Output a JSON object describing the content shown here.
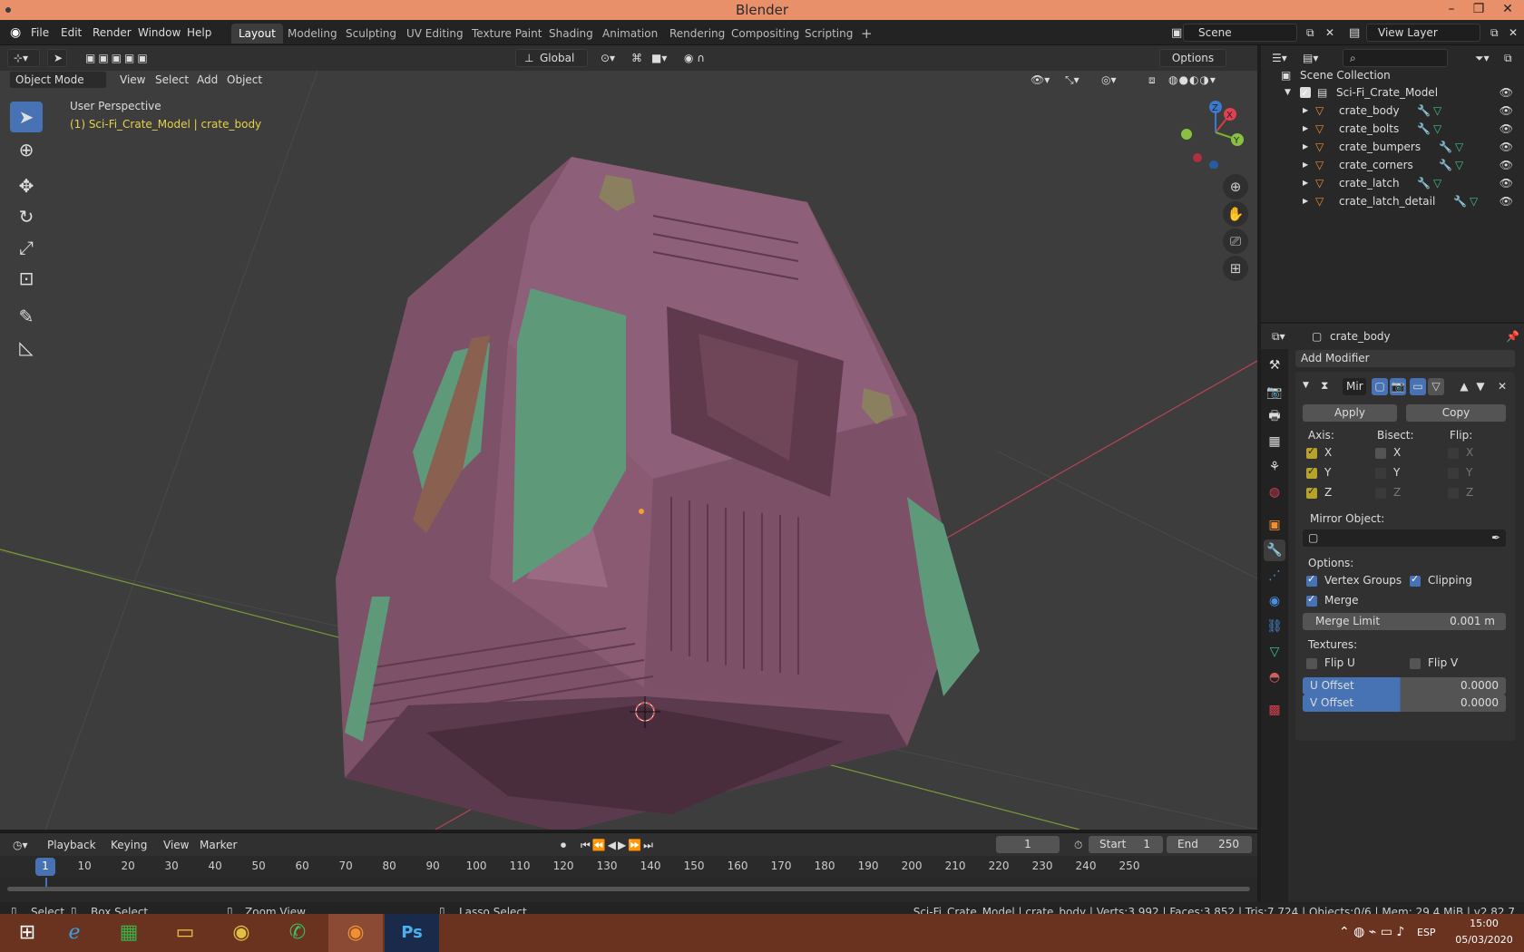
{
  "app_title": "Blender",
  "menu": [
    "File",
    "Edit",
    "Render",
    "Window",
    "Help"
  ],
  "workspaces": [
    "Layout",
    "Modeling",
    "Sculpting",
    "UV Editing",
    "Texture Paint",
    "Shading",
    "Animation",
    "Rendering",
    "Compositing",
    "Scripting"
  ],
  "active_workspace": "Layout",
  "scene_field": "Scene",
  "view_layer_field": "View Layer",
  "transform_orientation": "Global",
  "options_label": "Options",
  "viewport": {
    "mode": "Object Mode",
    "menus": [
      "View",
      "Select",
      "Add",
      "Object"
    ],
    "perspective_label": "User Perspective",
    "active_info": "(1) Sci-Fi_Crate_Model | crate_body",
    "gizmo_axes": {
      "x": "X",
      "y": "Y",
      "z": "Z"
    }
  },
  "outliner": {
    "root": "Scene Collection",
    "collection": "Sci-Fi_Crate_Model",
    "objects": [
      "crate_body",
      "crate_bolts",
      "crate_bumpers",
      "crate_corners",
      "crate_latch",
      "crate_latch_detail"
    ]
  },
  "properties": {
    "object_name": "crate_body",
    "add_modifier": "Add Modifier",
    "modifier_name": "Mir",
    "apply": "Apply",
    "copy": "Copy",
    "axis_label": "Axis:",
    "bisect_label": "Bisect:",
    "flip_label": "Flip:",
    "axes": [
      "X",
      "Y",
      "Z"
    ],
    "axis_checked": [
      true,
      true,
      true
    ],
    "mirror_object_label": "Mirror Object:",
    "options_label": "Options:",
    "vertex_groups": "Vertex Groups",
    "clipping": "Clipping",
    "merge": "Merge",
    "merge_limit_label": "Merge Limit",
    "merge_limit_value": "0.001 m",
    "textures_label": "Textures:",
    "flip_u": "Flip U",
    "flip_v": "Flip V",
    "u_offset_label": "U Offset",
    "u_offset_value": "0.0000",
    "v_offset_label": "V Offset",
    "v_offset_value": "0.0000"
  },
  "timeline": {
    "menus": [
      "Playback",
      "Keying",
      "View",
      "Marker"
    ],
    "current_frame": "1",
    "start_label": "Start",
    "start_value": "1",
    "end_label": "End",
    "end_value": "250",
    "ruler": [
      "1",
      "10",
      "20",
      "30",
      "40",
      "50",
      "60",
      "70",
      "80",
      "90",
      "100",
      "110",
      "120",
      "130",
      "140",
      "150",
      "160",
      "170",
      "180",
      "190",
      "200",
      "210",
      "220",
      "230",
      "240",
      "250"
    ]
  },
  "statusbar": {
    "select": "Select",
    "box_select": "Box Select",
    "zoom_view": "Zoom View",
    "lasso_select": "Lasso Select",
    "stats": "Sci-Fi_Crate_Model | crate_body | Verts:3,992 | Faces:3,852 | Tris:7,724 | Objects:0/6 | Mem: 29.4 MiB | v2.82.7"
  },
  "taskbar": {
    "language": "ESP",
    "time": "15:00",
    "date": "05/03/2020"
  },
  "colors": {
    "accent": "#4772b3",
    "crate_body": "#8a5c74",
    "crate_green": "#5e9a7a",
    "titlebar": "#e8906a",
    "taskbar": "#6a3320"
  }
}
